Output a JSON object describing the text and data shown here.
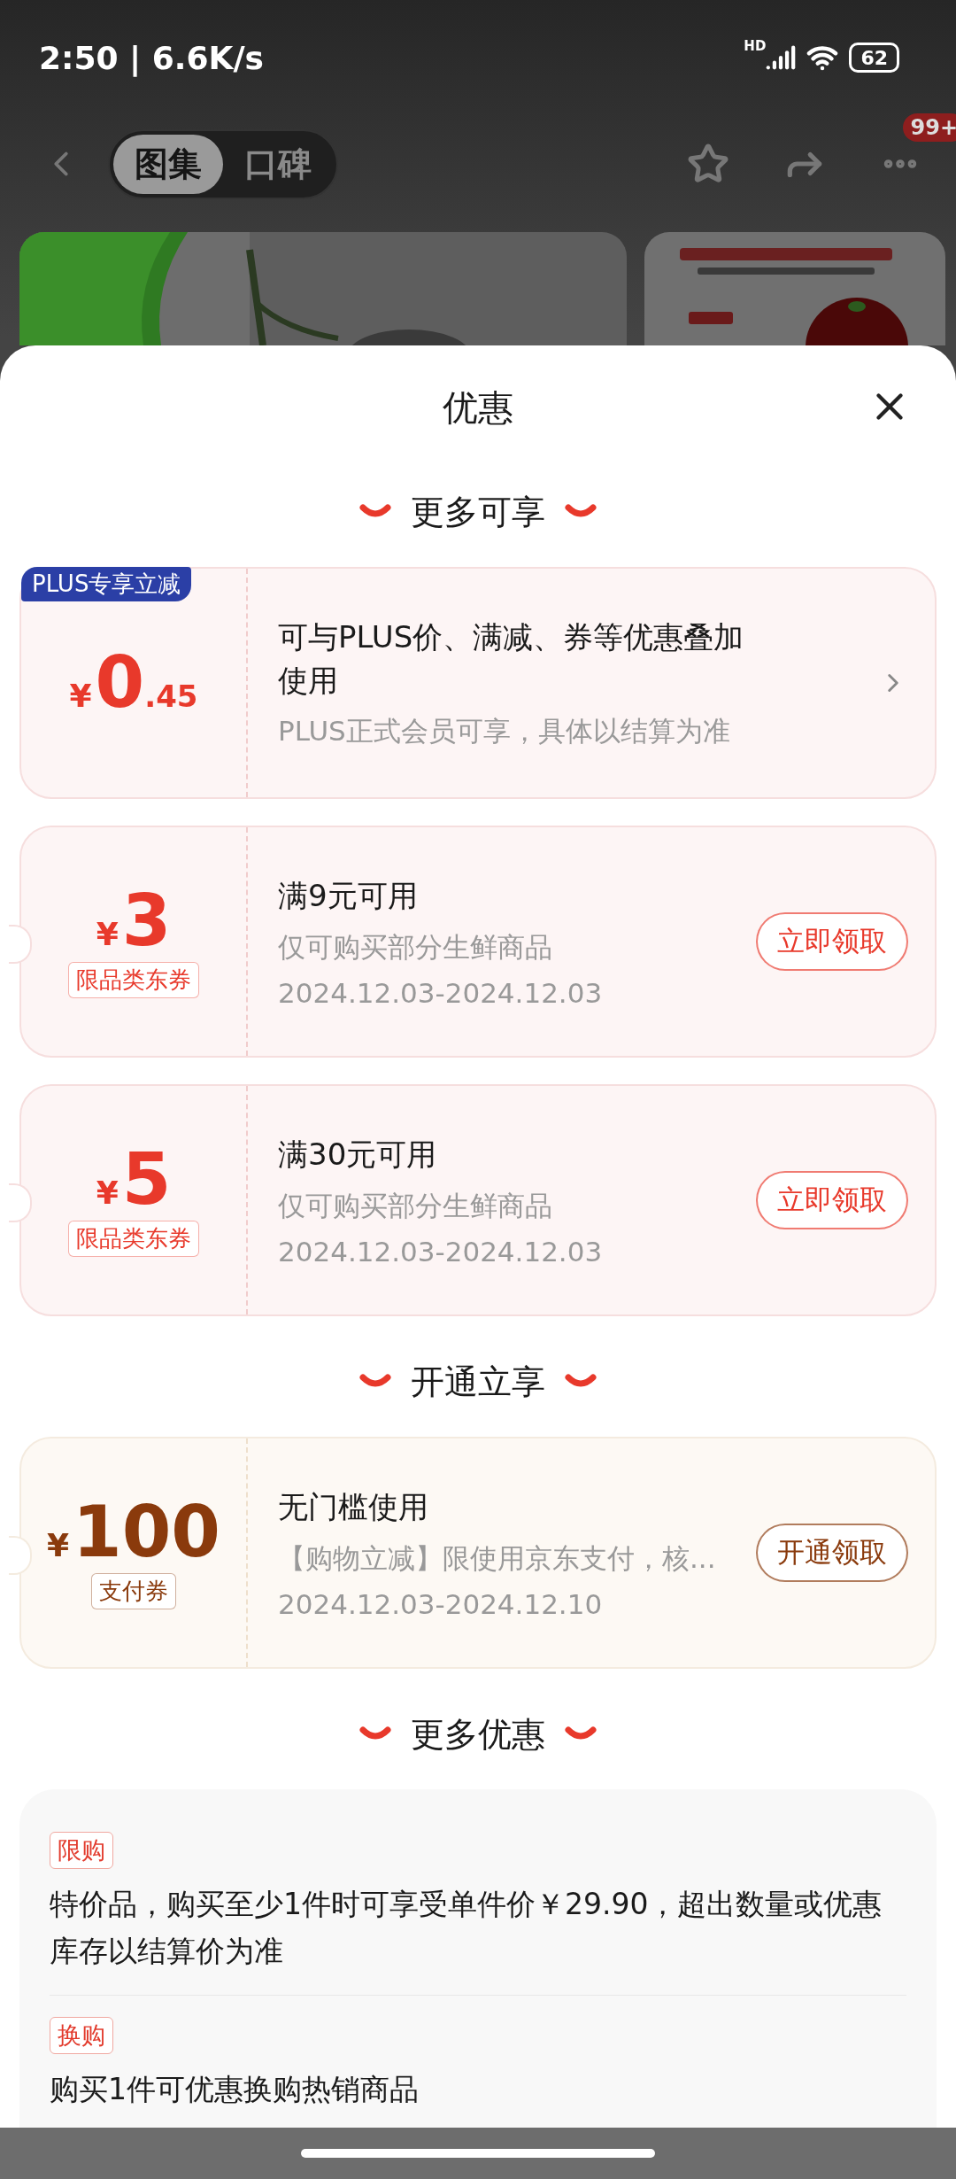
{
  "status_bar": {
    "time": "2:50 | 6.6K/s",
    "network": "HD",
    "battery": "62"
  },
  "nav": {
    "tabs": [
      {
        "label": "图集",
        "selected": true
      },
      {
        "label": "口碑",
        "selected": false
      }
    ],
    "badge": "99+"
  },
  "sheet": {
    "title": "优惠",
    "sections": [
      {
        "title": "更多可享",
        "coupons": [
          {
            "kind": "plus",
            "badge": "PLUS专享立减",
            "currency": "¥",
            "amount": "0",
            "amount_decimal": ".45",
            "title": "可与PLUS价、满减、券等优惠叠加使用",
            "subtitle": "PLUS正式会员可享，具体以结算为准"
          },
          {
            "kind": "category",
            "currency": "¥",
            "amount": "3",
            "tag": "限品类东券",
            "title": "满9元可用",
            "subtitle": "仅可购买部分生鲜商品",
            "dates": "2024.12.03-2024.12.03",
            "action": "立即领取"
          },
          {
            "kind": "category",
            "currency": "¥",
            "amount": "5",
            "tag": "限品类东券",
            "title": "满30元可用",
            "subtitle": "仅可购买部分生鲜商品",
            "dates": "2024.12.03-2024.12.03",
            "action": "立即领取"
          }
        ]
      },
      {
        "title": "开通立享",
        "coupons": [
          {
            "kind": "payment",
            "currency": "¥",
            "amount": "100",
            "tag": "支付券",
            "title": "无门槛使用",
            "subtitle": "【购物立减】限使用京东支付，核...",
            "dates": "2024.12.03-2024.12.10",
            "action": "开通领取"
          }
        ]
      },
      {
        "title": "更多优惠",
        "offers": [
          {
            "tag": "限购",
            "text": "特价品，购买至少1件时可享受单件价￥29.90，超出数量或优惠库存以结算价为准"
          },
          {
            "tag": "换购",
            "text": "购买1件可优惠换购热销商品"
          }
        ]
      }
    ]
  }
}
